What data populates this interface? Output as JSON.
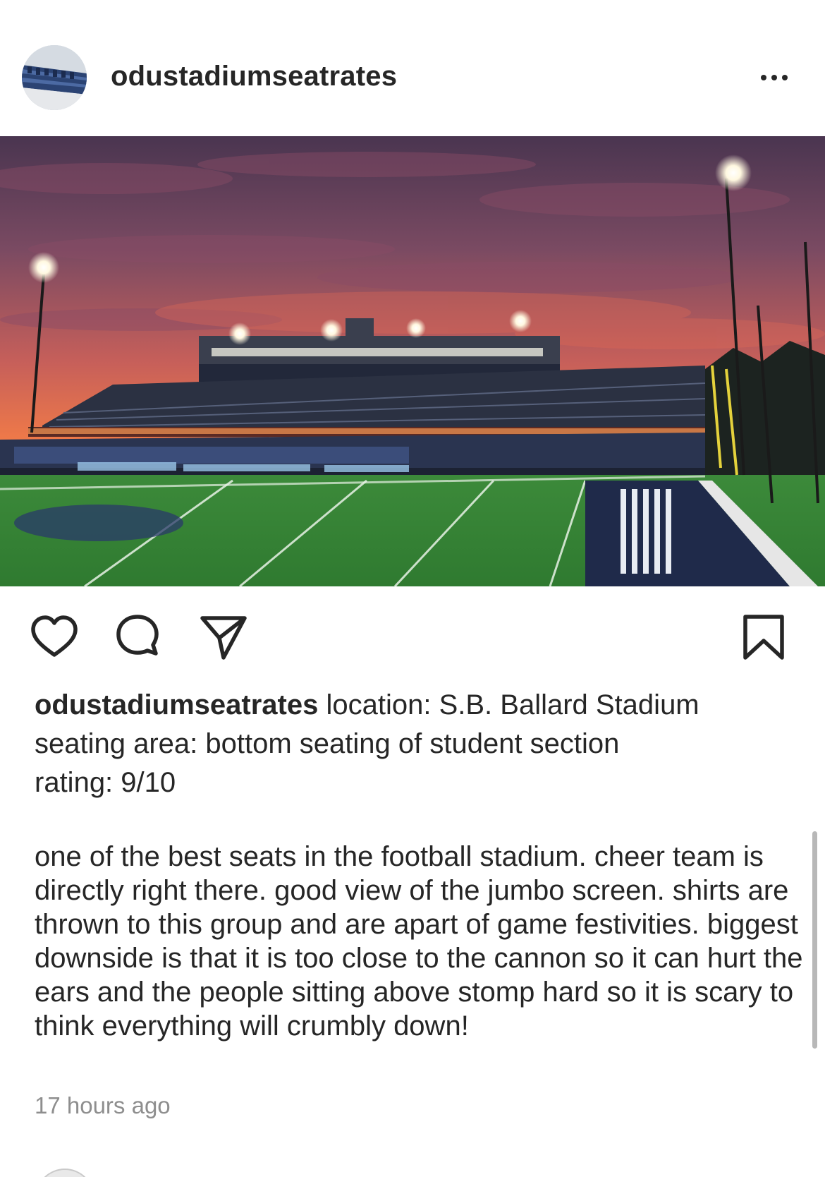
{
  "post": {
    "username": "odustadiumseatrates",
    "avatar_icon": "stadium-seats-avatar",
    "more_icon": "more-dots-icon",
    "photo_alt": "S.B. Ballard Stadium at sunset"
  },
  "actions": {
    "like_icon": "heart-icon",
    "comment_icon": "comment-bubble-icon",
    "share_icon": "paper-plane-icon",
    "save_icon": "bookmark-icon"
  },
  "caption": {
    "username": "odustadiumseatrates",
    "line1": "location: S.B. Ballard Stadium",
    "line2": "seating area: bottom seating  of student section",
    "line3": "rating: 9/10",
    "body": "one of the best seats in the football stadium. cheer team is directly right there. good view of the jumbo screen. shirts are thrown to this group and are apart of game festivities. biggest downside is that it is too close to the cannon so it can hurt the ears and the people sitting above stomp hard so it is scary to think everything will crumbly down!"
  },
  "timestamp": "17 hours ago",
  "colors": {
    "text": "#262626",
    "muted": "#8e8e8e",
    "sky_top": "#5b3e5a",
    "sky_glow": "#ff7a45",
    "turf": "#3f8f3c",
    "endzone": "#1f2a4a"
  }
}
